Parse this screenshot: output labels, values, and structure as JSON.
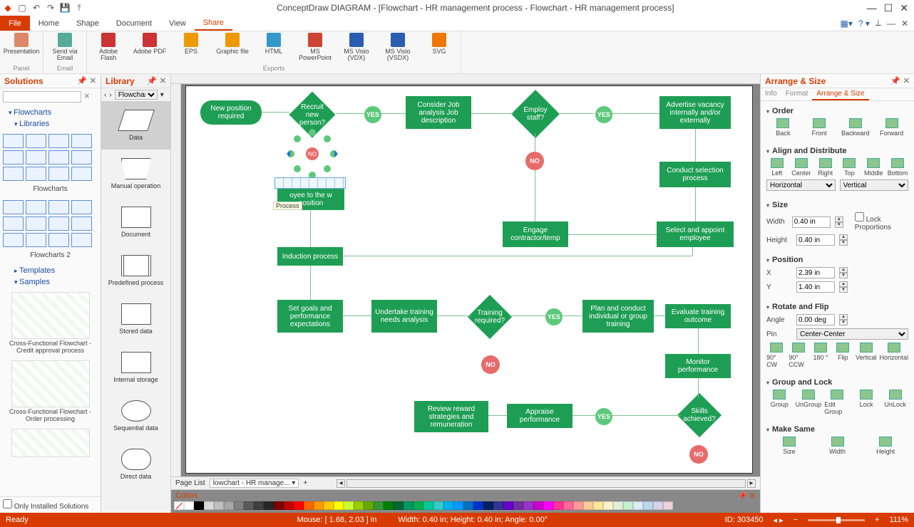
{
  "app_title": "ConceptDraw DIAGRAM - [Flowchart - HR management process - Flowchart - HR management process]",
  "menu_tabs": [
    "File",
    "Home",
    "Shape",
    "Document",
    "View",
    "Share"
  ],
  "active_tab": "Share",
  "ribbon": {
    "groups": [
      {
        "label": "Panel",
        "items": [
          {
            "lbl": "Presentation",
            "c": "#d86"
          }
        ]
      },
      {
        "label": "Email",
        "items": [
          {
            "lbl": "Send via Email",
            "c": "#5a9"
          }
        ]
      },
      {
        "label": "Exports",
        "items": [
          {
            "lbl": "Adobe Flash",
            "c": "#c33"
          },
          {
            "lbl": "Adobe PDF",
            "c": "#c33"
          },
          {
            "lbl": "EPS",
            "c": "#e90"
          },
          {
            "lbl": "Graphic file",
            "c": "#e90"
          },
          {
            "lbl": "HTML",
            "c": "#39c"
          },
          {
            "lbl": "MS PowerPoint",
            "c": "#c43"
          },
          {
            "lbl": "MS Visio (VDX)",
            "c": "#2a5db0"
          },
          {
            "lbl": "MS Visio (VSDX)",
            "c": "#2a5db0"
          },
          {
            "lbl": "SVG",
            "c": "#e70"
          }
        ]
      }
    ]
  },
  "solutions": {
    "title": "Solutions",
    "tree": [
      "Flowcharts",
      "Libraries"
    ],
    "sets": [
      {
        "label": "Flowcharts"
      },
      {
        "label": "Flowcharts 2"
      }
    ],
    "extra": [
      "Templates",
      "Samples"
    ],
    "samples": [
      "Cross-Functional Flowchart - Credit approval process",
      "Cross-Functional Flowchart - Order processing"
    ],
    "only_installed": "Only Installed Solutions"
  },
  "library": {
    "title": "Library",
    "combo": "Flowcharts ...",
    "shapes": [
      "Data",
      "Manual operation",
      "Document",
      "Predefined process",
      "Stored data",
      "Internal storage",
      "Sequential data",
      "Direct data"
    ]
  },
  "canvas": {
    "page_tab": "lowchart - HR manage...",
    "page_list_label": "Page List",
    "nodes": {
      "n1": "New position required",
      "n2": "Recruit new person?",
      "n3": "Consider Job analysis Job description",
      "n4": "Employ staff?",
      "n5": "Advertise vacancy internally and/or externally",
      "n6": "Conduct selection process",
      "n7": "Engage contractor/temp",
      "n8": "Select and appoint employee",
      "n9": "Induction process",
      "n10": "Set goals and performance expectations",
      "n11": "Undertake training needs analysis",
      "n12": "Training required?",
      "n13": "Plan and conduct individual or group training",
      "n14": "Evaluate training outcome",
      "n15": "Monitor performance",
      "n16": "Skills achieved?",
      "n17": "Appraise performance",
      "n18": "Review reward strategies and remuneration",
      "sel": "oyee to the w position",
      "sel_tip": "Process",
      "no_tip": "NO"
    },
    "yes": "YES",
    "no": "NO"
  },
  "colors_title": "Colors",
  "right": {
    "title": "Arrange & Size",
    "subtabs": [
      "Info",
      "Format",
      "Arrange & Size"
    ],
    "order": {
      "title": "Order",
      "btns": [
        "Back",
        "Front",
        "Backward",
        "Forward"
      ]
    },
    "align": {
      "title": "Align and Distribute",
      "btns": [
        "Left",
        "Center",
        "Right",
        "Top",
        "Middle",
        "Bottom"
      ],
      "horiz": "Horizontal",
      "vert": "Vertical"
    },
    "size": {
      "title": "Size",
      "w_label": "Width",
      "w": "0.40 in",
      "h_label": "Height",
      "h": "0.40 in",
      "lock": "Lock Proportions"
    },
    "position": {
      "title": "Position",
      "x_label": "X",
      "x": "2.39 in",
      "y_label": "Y",
      "y": "1.40 in"
    },
    "rotate": {
      "title": "Rotate and Flip",
      "a_label": "Angle",
      "angle": "0.00 deg",
      "p_label": "Pin",
      "pin": "Center-Center",
      "btns": [
        "90° CW",
        "90° CCW",
        "180 °",
        "Flip",
        "Vertical",
        "Horizontal"
      ]
    },
    "group": {
      "title": "Group and Lock",
      "btns": [
        "Group",
        "UnGroup",
        "Edit Group",
        "Lock",
        "UnLock"
      ]
    },
    "makesame": {
      "title": "Make Same",
      "btns": [
        "Size",
        "Width",
        "Height"
      ]
    }
  },
  "status": {
    "ready": "Ready",
    "mouse": "Mouse: [ 1.68, 2.03 ] in",
    "dims": "Width: 0.40 in;  Height: 0.40 in;  Angle: 0.00°",
    "id": "ID: 303450",
    "zoom": "111%"
  },
  "palette": [
    "#ffffff",
    "#000000",
    "#d9d9d9",
    "#bfbfbf",
    "#a6a6a6",
    "#808080",
    "#595959",
    "#404040",
    "#262626",
    "#7f0000",
    "#c00000",
    "#ff0000",
    "#ff6600",
    "#ff9900",
    "#ffcc00",
    "#ffff00",
    "#ccff33",
    "#99cc00",
    "#66aa00",
    "#339933",
    "#008000",
    "#006633",
    "#009966",
    "#00b050",
    "#00cc99",
    "#33cccc",
    "#00b0f0",
    "#0099ff",
    "#0070c0",
    "#0033cc",
    "#002060",
    "#333399",
    "#6600cc",
    "#7030a0",
    "#9933cc",
    "#cc00cc",
    "#ff00ff",
    "#ff3399",
    "#ff6699",
    "#ff9999",
    "#ffcc99",
    "#ffe699",
    "#fff2cc",
    "#e2efda",
    "#c6efce",
    "#ddebf7",
    "#bdd7ee",
    "#d9d2e9",
    "#ead1dc"
  ]
}
